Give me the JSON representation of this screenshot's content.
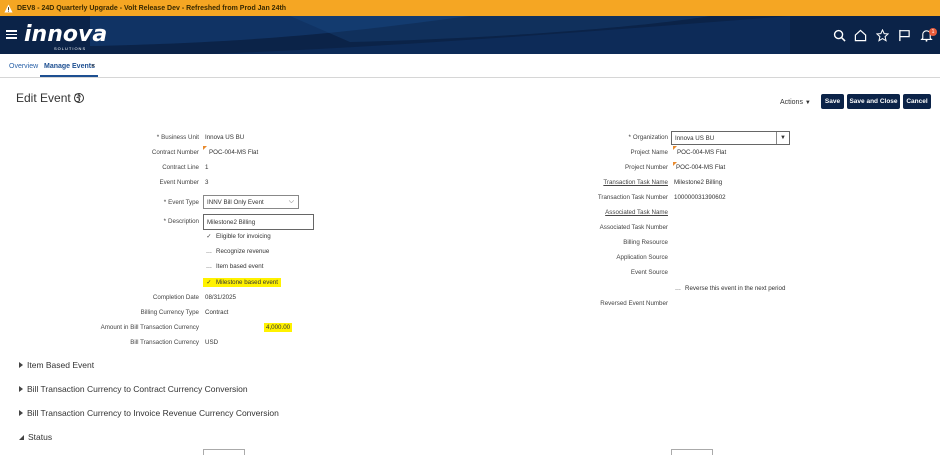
{
  "banner": {
    "text": "DEV8 - 24D Quarterly Upgrade - Volt Release Dev - Refreshed from Prod Jan 24th"
  },
  "header": {
    "logo": "innova",
    "logo_sub": "SOLUTIONS",
    "notif_count": "1"
  },
  "tabs": [
    {
      "label": "Overview"
    },
    {
      "label": "Manage Events",
      "close": "×"
    }
  ],
  "page": {
    "title": "Edit Event 3",
    "help": "?"
  },
  "toolbar": {
    "actions_label": "Actions",
    "actions_caret": "▼",
    "save_label": "Save",
    "save_close_label": "Save and Close",
    "cancel_label": "Cancel"
  },
  "left": {
    "business_unit": {
      "label": "Business Unit",
      "value": "Innova US BU"
    },
    "contract_number": {
      "label": "Contract Number",
      "value": "POC-004-MS Flat"
    },
    "contract_line": {
      "label": "Contract Line",
      "value": "1"
    },
    "event_number": {
      "label": "Event Number",
      "value": "3"
    },
    "event_type": {
      "label": "Event Type",
      "value": "INNV Bill Only Event"
    },
    "description": {
      "label": "Description",
      "value": "Milestone2 Billing"
    },
    "checkboxes": [
      {
        "label": "Eligible for invoicing",
        "checked": true,
        "highlight": false
      },
      {
        "label": "Recognize revenue",
        "checked": false,
        "highlight": false
      },
      {
        "label": "Item based event",
        "checked": false,
        "highlight": false
      },
      {
        "label": "Milestone based event",
        "checked": true,
        "highlight": true
      }
    ],
    "completion_date": {
      "label": "Completion Date",
      "value": "08/31/2025"
    },
    "billing_currency_type": {
      "label": "Billing Currency Type",
      "value": "Contract"
    },
    "amount": {
      "label": "Amount in Bill Transaction Currency",
      "value": "4,000.00"
    },
    "bill_transaction_currency": {
      "label": "Bill Transaction Currency",
      "value": "USD"
    }
  },
  "right": {
    "organization": {
      "label": "Organization",
      "value": "Innova US BU"
    },
    "project_name": {
      "label": "Project Name",
      "value": "POC-004-MS Flat"
    },
    "project_number": {
      "label": "Project Number",
      "value": "POC-004-MS Flat"
    },
    "transaction_task_name": {
      "label": "Transaction Task Name",
      "value": "Milestone2 Billing"
    },
    "transaction_task_number": {
      "label": "Transaction Task Number",
      "value": "100000031390602"
    },
    "associated_task_name": {
      "label": "Associated Task Name"
    },
    "associated_task_number": {
      "label": "Associated Task Number"
    },
    "billing_resource": {
      "label": "Billing Resource"
    },
    "application_source": {
      "label": "Application Source"
    },
    "event_source": {
      "label": "Event Source"
    },
    "reverse_checkbox": {
      "label": "Reverse this event in the next period",
      "checked": false
    },
    "reversed_event_number": {
      "label": "Reversed Event Number"
    }
  },
  "sections": [
    {
      "label": "Item Based Event",
      "expanded": false
    },
    {
      "label": "Bill Transaction Currency to Contract Currency Conversion",
      "expanded": false
    },
    {
      "label": "Bill Transaction Currency to Invoice Revenue Currency Conversion",
      "expanded": false
    },
    {
      "label": "Status",
      "expanded": true
    }
  ],
  "colors": {
    "header_bg": "#0b2348",
    "banner_bg": "#f5a623",
    "highlight": "#fff200",
    "link": "#2a62a8"
  }
}
